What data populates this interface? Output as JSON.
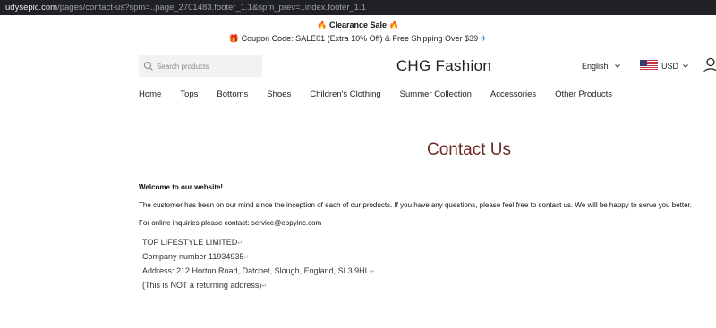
{
  "browser": {
    "url_host": "udysepic.com",
    "url_path": "/pages/contact-us?spm=..page_2701483.footer_1.1&spm_prev=..index.footer_1.1"
  },
  "announcement": {
    "line1": "Clearance Sale",
    "line2": "Coupon Code: SALE01 (Extra 10% Off) & Free Shipping Over $39"
  },
  "header": {
    "search_placeholder": "Search products",
    "logo": "CHG Fashion",
    "language": "English",
    "currency": "USD"
  },
  "nav": {
    "items": [
      "Home",
      "Tops",
      "Bottoms",
      "Shoes",
      "Children's Clothing",
      "Summer Collection",
      "Accessories",
      "Other Products"
    ]
  },
  "page": {
    "title": "Contact Us",
    "welcome": "Welcome to our website!",
    "paragraph": "The customer has been on our mind since the inception of each of our products. If you have any questions, please feel free to contact us. We will be happy to serve you better.",
    "inquiries": "For online inquiries please contact: service@eopyinc.com",
    "address_lines": [
      "TOP LIFESTYLE LIMITED",
      "Company number 11934935",
      "Address: 212 Horton Road, Datchet, Slough, England, SL3 9HL",
      "(This is NOT a returning address)"
    ],
    "return_mark": "↵"
  },
  "colors": {
    "title": "#6b2a24",
    "url_bar_bg": "#202124"
  }
}
